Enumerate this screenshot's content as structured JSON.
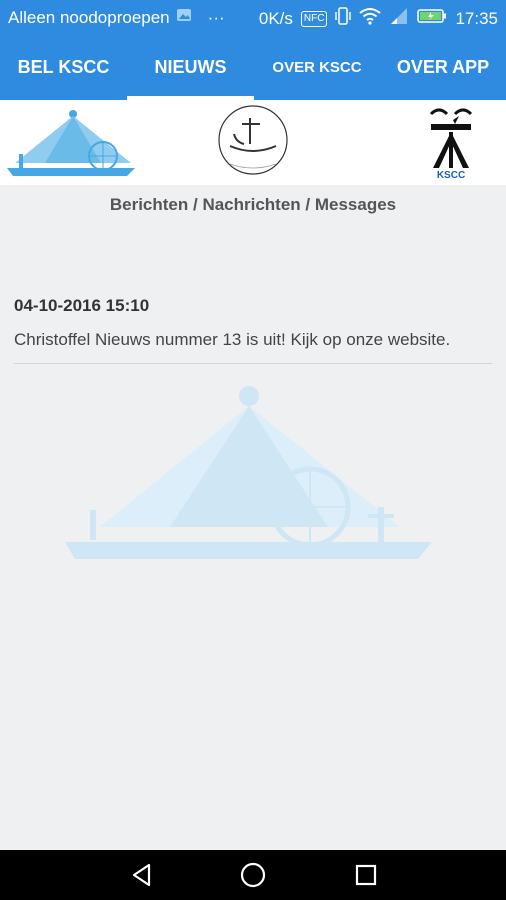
{
  "status_bar": {
    "carrier": "Alleen noodoproepen",
    "more": "···",
    "speed": "0K/s",
    "nfc": "NFC",
    "time": "17:35"
  },
  "tabs": [
    {
      "label": "BEL KSCC"
    },
    {
      "label": "NIEUWS",
      "selected": true
    },
    {
      "label": "OVER KSCC"
    },
    {
      "label": "OVER APP"
    }
  ],
  "logos": {
    "kscc_text": "KSCC"
  },
  "page": {
    "subtitle": "Berichten / Nachrichten / Messages"
  },
  "messages": [
    {
      "date": "04-10-2016 15:10",
      "text": "Christoffel Nieuws nummer 13 is uit! Kijk op onze website."
    }
  ],
  "colors": {
    "primary": "#2f8be0",
    "background": "#eef0f1",
    "watermark": "#cfe6f5"
  }
}
